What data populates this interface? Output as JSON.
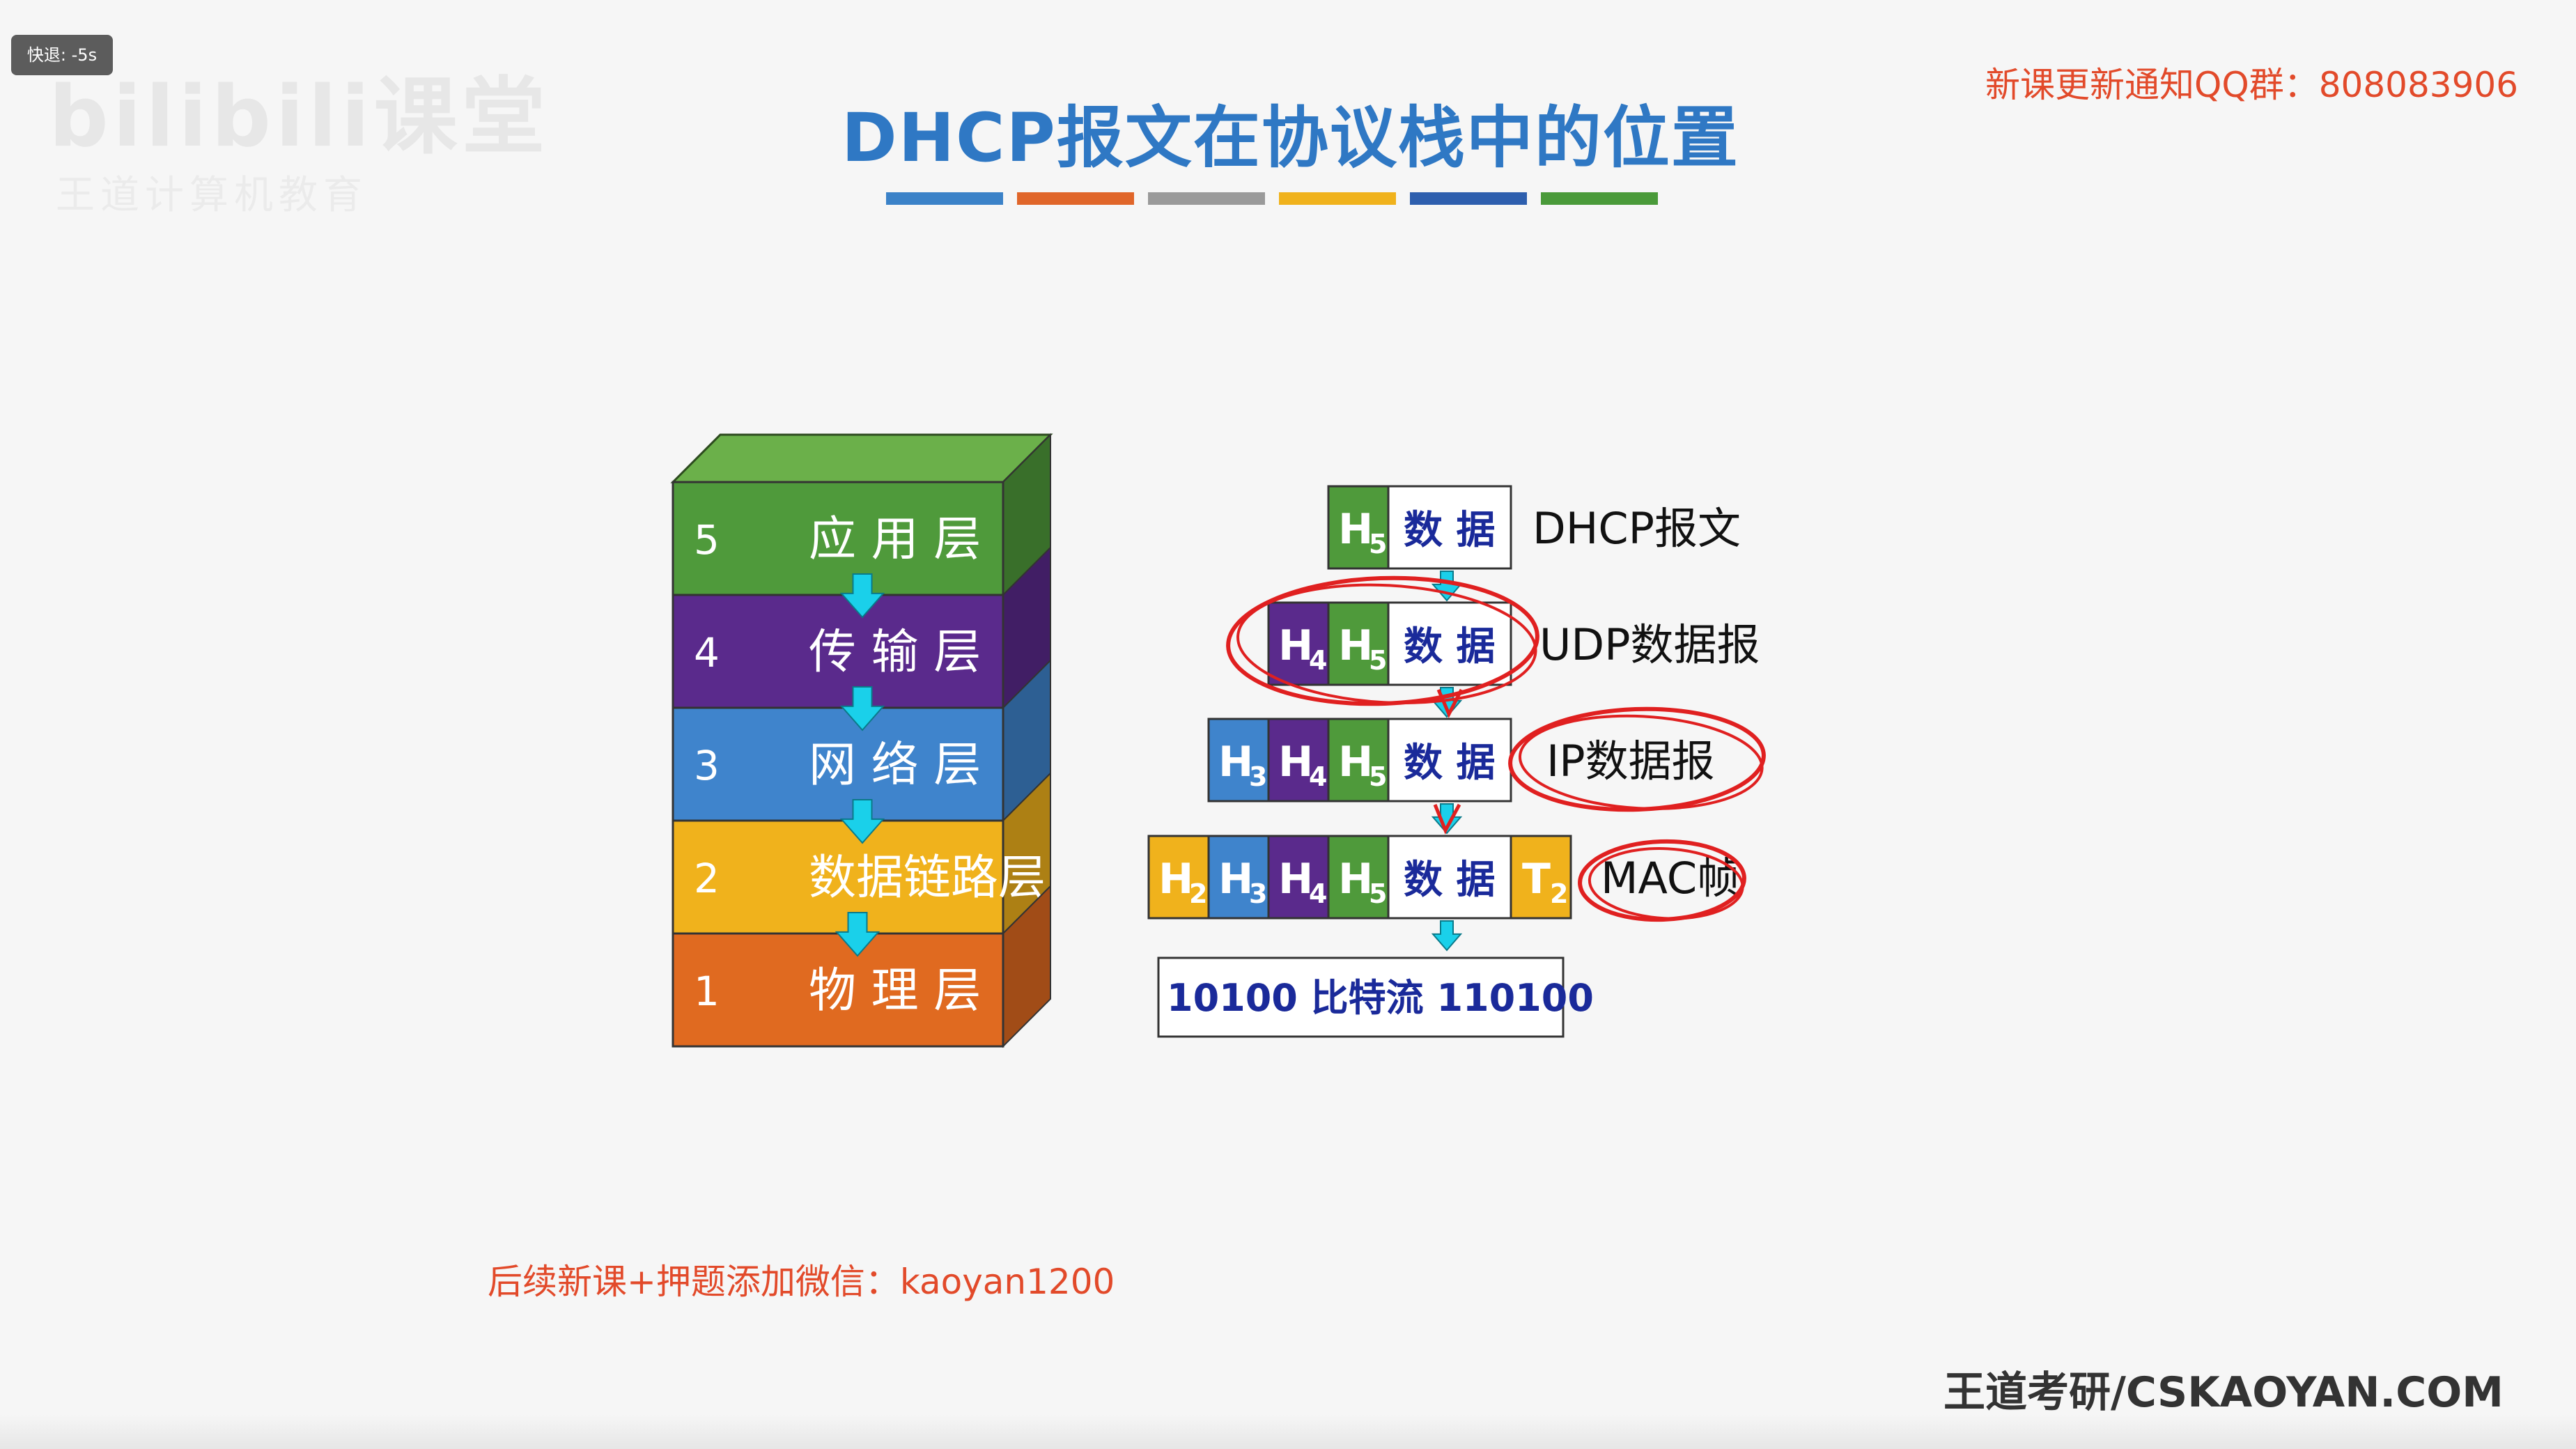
{
  "overlay": {
    "seek_label": "快退: -5s"
  },
  "watermark": {
    "logo": "bilibili课堂",
    "subtitle": "王道计算机教育"
  },
  "header": {
    "title": "DHCP报文在协议栈中的位置",
    "qq_notice": "新课更新通知QQ群：808083906",
    "title_bar_colors": [
      "#3b82c8",
      "#e0662a",
      "#9a9a9a",
      "#f0b21c",
      "#2e5fae",
      "#4a9a3a"
    ]
  },
  "stack": {
    "layers": [
      {
        "num": "5",
        "name": "应 用 层",
        "color": "#4f9a3b"
      },
      {
        "num": "4",
        "name": "传 输 层",
        "color": "#5a2a8c"
      },
      {
        "num": "3",
        "name": "网 络 层",
        "color": "#3f84cc"
      },
      {
        "num": "2",
        "name": "数据链路层",
        "color": "#f0b21c"
      },
      {
        "num": "1",
        "name": "物 理 层",
        "color": "#e06a20"
      }
    ]
  },
  "encapsulation": {
    "rows": [
      {
        "label": "DHCP报文",
        "blocks": [
          {
            "h": "H",
            "sub": "5",
            "color": "#4f9a3b"
          }
        ],
        "data": "数 据"
      },
      {
        "label": "UDP数据报",
        "blocks": [
          {
            "h": "H",
            "sub": "4",
            "color": "#5a2a8c"
          },
          {
            "h": "H",
            "sub": "5",
            "color": "#4f9a3b"
          }
        ],
        "data": "数 据"
      },
      {
        "label": "IP数据报",
        "blocks": [
          {
            "h": "H",
            "sub": "3",
            "color": "#3f84cc"
          },
          {
            "h": "H",
            "sub": "4",
            "color": "#5a2a8c"
          },
          {
            "h": "H",
            "sub": "5",
            "color": "#4f9a3b"
          }
        ],
        "data": "数 据"
      },
      {
        "label": "MAC帧",
        "blocks": [
          {
            "h": "H",
            "sub": "2",
            "color": "#f0b21c"
          },
          {
            "h": "H",
            "sub": "3",
            "color": "#3f84cc"
          },
          {
            "h": "H",
            "sub": "4",
            "color": "#5a2a8c"
          },
          {
            "h": "H",
            "sub": "5",
            "color": "#4f9a3b"
          }
        ],
        "data": "数 据",
        "trailer": {
          "h": "T",
          "sub": "2",
          "color": "#f0b21c"
        }
      }
    ],
    "bitstream": "10100 比特流 110100"
  },
  "footer": {
    "wechat_notice": "后续新课+押题添加微信：kaoyan1200",
    "site": "王道考研/CSKAOYAN.COM"
  }
}
